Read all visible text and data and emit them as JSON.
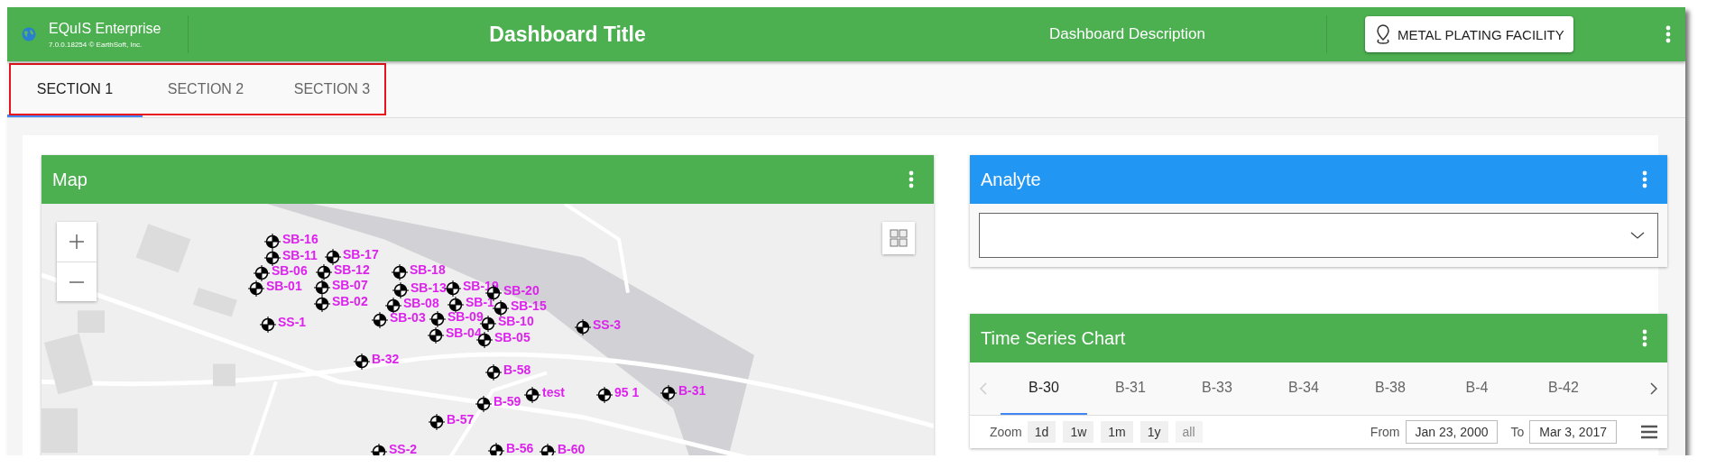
{
  "app": {
    "name": "EQuIS Enterprise",
    "version": "7.0.0.18254 © EarthSoft, Inc."
  },
  "header": {
    "title": "Dashboard Title",
    "description": "Dashboard Description",
    "facility_button": "METAL PLATING FACILITY"
  },
  "tabs_highlighted": true,
  "tabs": [
    {
      "label": "SECTION 1",
      "selected": true
    },
    {
      "label": "SECTION 2",
      "selected": false
    },
    {
      "label": "SECTION 3",
      "selected": false
    }
  ],
  "map": {
    "title": "Map",
    "markers": [
      {
        "label": "SB-16"
      },
      {
        "label": "SB-11"
      },
      {
        "label": "SB-06"
      },
      {
        "label": "SB-01"
      },
      {
        "label": "SS-1"
      },
      {
        "label": "SB-17"
      },
      {
        "label": "SB-12"
      },
      {
        "label": "SB-07"
      },
      {
        "label": "SB-02"
      },
      {
        "label": "SB-18"
      },
      {
        "label": "SB-13"
      },
      {
        "label": "SB-08"
      },
      {
        "label": "SB-03"
      },
      {
        "label": "SB-19"
      },
      {
        "label": "SB-1"
      },
      {
        "label": "SB-09"
      },
      {
        "label": "SB-04"
      },
      {
        "label": "SB-20"
      },
      {
        "label": "SB-15"
      },
      {
        "label": "SB-10"
      },
      {
        "label": "SB-05"
      },
      {
        "label": "B-32"
      },
      {
        "label": "B-58"
      },
      {
        "label": "B-59"
      },
      {
        "label": "B-57"
      },
      {
        "label": "test"
      },
      {
        "label": "95 1"
      },
      {
        "label": "SS-3"
      },
      {
        "label": "B-31"
      },
      {
        "label": "SS-2"
      },
      {
        "label": "B-56"
      },
      {
        "label": "B-60"
      }
    ]
  },
  "analyte": {
    "title": "Analyte"
  },
  "time_series": {
    "title": "Time Series Chart",
    "tabs": [
      {
        "label": "B-30",
        "selected": true
      },
      {
        "label": "B-31",
        "selected": false
      },
      {
        "label": "B-33",
        "selected": false
      },
      {
        "label": "B-34",
        "selected": false
      },
      {
        "label": "B-38",
        "selected": false
      },
      {
        "label": "B-4",
        "selected": false
      },
      {
        "label": "B-42",
        "selected": false
      }
    ],
    "zoom_label": "Zoom",
    "zoom_buttons": [
      {
        "label": "1d",
        "disabled": false
      },
      {
        "label": "1w",
        "disabled": false
      },
      {
        "label": "1m",
        "disabled": false
      },
      {
        "label": "1y",
        "disabled": false
      },
      {
        "label": "all",
        "disabled": true
      }
    ],
    "from_label": "From",
    "from_value": "Jan 23, 2000",
    "to_label": "To",
    "to_value": "Mar 3, 2017"
  }
}
